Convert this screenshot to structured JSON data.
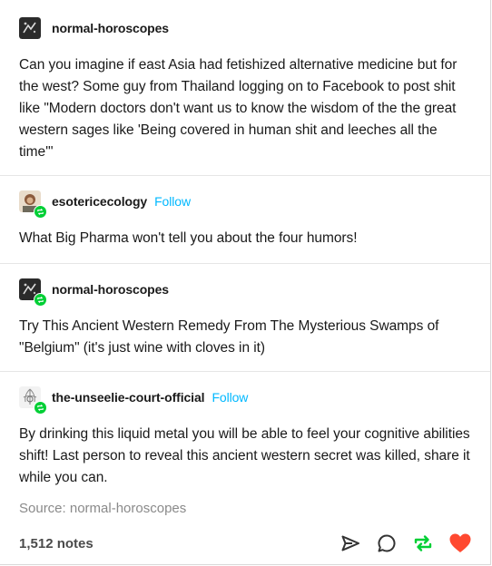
{
  "posts": [
    {
      "username": "normal-horoscopes",
      "follow": "",
      "text": "Can you imagine if east Asia had fetishized alternative medicine but for the west? Some guy from Thailand logging on to Facebook to post shit like \"Modern doctors don't want us to know the wisdom of the the great western sages like 'Being covered in human shit and leeches all the time'\""
    },
    {
      "username": "esotericecology",
      "follow": "Follow",
      "text": "What Big Pharma won't tell you about the four humors!"
    },
    {
      "username": "normal-horoscopes",
      "follow": "",
      "text": "Try This Ancient Western Remedy From The Mysterious Swamps of \"Belgium\" (it's just wine with cloves in it)"
    },
    {
      "username": "the-unseelie-court-official",
      "follow": "Follow",
      "text": "By drinking this liquid metal you will be able to feel your cognitive abilities shift! Last person to reveal this ancient western secret was killed, share it while you can."
    }
  ],
  "source": "Source: normal-horoscopes",
  "notes": "1,512 notes",
  "colors": {
    "follow": "#00b8ff",
    "reblog_green": "#00cf35",
    "like_red": "#ff4930",
    "text": "#1a1a1a",
    "muted": "#8a8a8a"
  },
  "icons": [
    "share-icon",
    "reply-icon",
    "reblog-icon",
    "like-icon"
  ]
}
